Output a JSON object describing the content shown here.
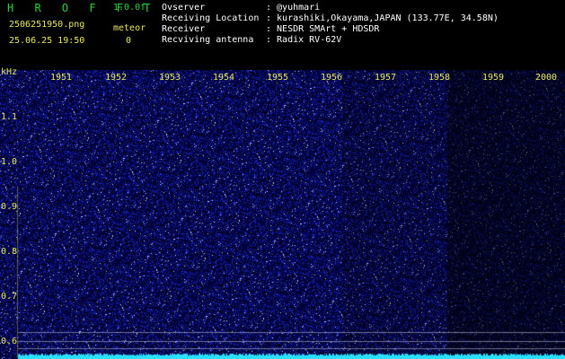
{
  "header": {
    "app_title": "H R O F F T",
    "version": "1.0.0f",
    "filename": "2506251950.png",
    "datetime": "25.06.25 19:50",
    "meteor_label": "meteor",
    "meteor_count": "0"
  },
  "info": [
    {
      "label": "Ovserver",
      "value": ": @yuhmari"
    },
    {
      "label": "Receiving Location",
      "value": ": kurashiki,Okayama,JAPAN (133.77E, 34.58N)"
    },
    {
      "label": "Receiver",
      "value": ": NESDR SMArt + HDSDR"
    },
    {
      "label": "Recviving antenna",
      "value": ": Radix RV-62V"
    }
  ],
  "axis": {
    "freq_unit": "kHz",
    "freq_labels": [
      "1.1",
      "1.0",
      "0.9",
      "0.8",
      "0.7",
      "0.6"
    ],
    "time_labels": [
      "1951",
      "1952",
      "1953",
      "1954",
      "1955",
      "1956",
      "1957",
      "1958",
      "1959",
      "2000"
    ]
  },
  "colors": {
    "background": "#000000",
    "spectrogram_base": "#0a0a5a",
    "noise_bright": "#3a4cff",
    "bottom_band": "#29e0ff",
    "text_green": "#2bd13a",
    "text_yellow": "#e8e85a"
  }
}
